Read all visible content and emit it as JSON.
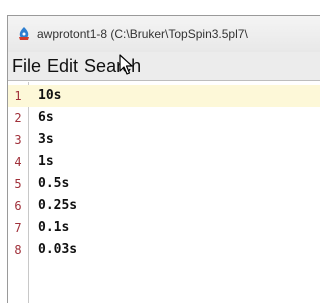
{
  "window": {
    "title": "awprotont1-8 (C:\\Bruker\\TopSpin3.5pl7\\",
    "app_icon": "topspin-app-icon"
  },
  "menu": {
    "items": [
      "File",
      "Edit",
      "Search"
    ]
  },
  "editor": {
    "current_line": 1,
    "lines": [
      {
        "number": "1",
        "text": "10s"
      },
      {
        "number": "2",
        "text": "6s"
      },
      {
        "number": "3",
        "text": "3s"
      },
      {
        "number": "4",
        "text": "1s"
      },
      {
        "number": "5",
        "text": "0.5s"
      },
      {
        "number": "6",
        "text": "0.25s"
      },
      {
        "number": "7",
        "text": "0.1s"
      },
      {
        "number": "8",
        "text": "0.03s"
      }
    ]
  },
  "colors": {
    "line_number": "#a0303a",
    "current_line_highlight": "#fdf8d8"
  }
}
